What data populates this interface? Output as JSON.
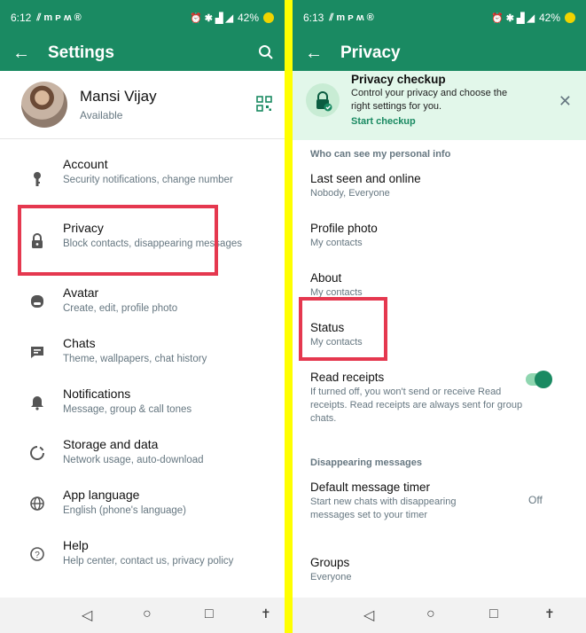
{
  "left": {
    "statusbar": {
      "time": "6:12",
      "battery": "42%"
    },
    "appbar": {
      "title": "Settings"
    },
    "profile": {
      "name": "Mansi Vijay",
      "status": "Available"
    },
    "items": [
      {
        "title": "Account",
        "subtitle": "Security notifications, change number",
        "icon": "key-icon"
      },
      {
        "title": "Privacy",
        "subtitle": "Block contacts, disappearing messages",
        "icon": "lock-icon"
      },
      {
        "title": "Avatar",
        "subtitle": "Create, edit, profile photo",
        "icon": "avatar-icon"
      },
      {
        "title": "Chats",
        "subtitle": "Theme, wallpapers, chat history",
        "icon": "chat-icon"
      },
      {
        "title": "Notifications",
        "subtitle": "Message, group & call tones",
        "icon": "bell-icon"
      },
      {
        "title": "Storage and data",
        "subtitle": "Network usage, auto-download",
        "icon": "storage-icon"
      },
      {
        "title": "App language",
        "subtitle": "English (phone's language)",
        "icon": "globe-icon"
      },
      {
        "title": "Help",
        "subtitle": "Help center, contact us, privacy policy",
        "icon": "help-icon"
      }
    ]
  },
  "right": {
    "statusbar": {
      "time": "6:13",
      "battery": "42%"
    },
    "appbar": {
      "title": "Privacy"
    },
    "checkup": {
      "title": "Privacy checkup",
      "description": "Control your privacy and choose the right settings for you.",
      "action": "Start checkup"
    },
    "section_personal": "Who can see my personal info",
    "items": [
      {
        "title": "Last seen and online",
        "subtitle": "Nobody, Everyone"
      },
      {
        "title": "Profile photo",
        "subtitle": "My contacts"
      },
      {
        "title": "About",
        "subtitle": "My contacts"
      },
      {
        "title": "Status",
        "subtitle": "My contacts"
      },
      {
        "title": "Read receipts",
        "subtitle": "If turned off, you won't send or receive Read receipts. Read receipts are always sent for group chats."
      }
    ],
    "read_receipts_enabled": true,
    "section_disappearing": "Disappearing messages",
    "timer": {
      "title": "Default message timer",
      "subtitle": "Start new chats with disappearing messages set to your timer",
      "value": "Off"
    },
    "groups": {
      "title": "Groups",
      "subtitle": "Everyone"
    }
  },
  "colors": {
    "brand": "#1a8a62",
    "highlight": "#e5384f",
    "divider": "#ffff00",
    "checkup_bg": "#e2f7ea"
  }
}
